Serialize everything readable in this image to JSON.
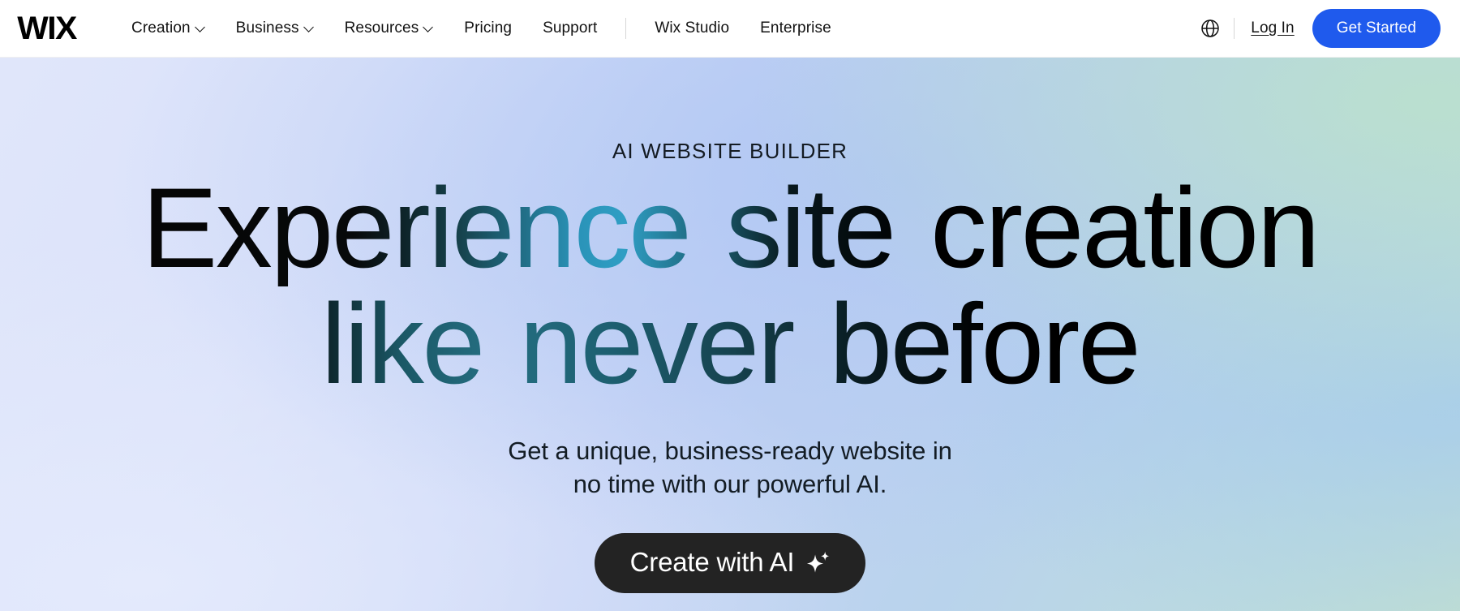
{
  "header": {
    "logo_text": "WIX",
    "nav_items": [
      {
        "label": "Creation",
        "has_dropdown": true,
        "name": "creation"
      },
      {
        "label": "Business",
        "has_dropdown": true,
        "name": "business"
      },
      {
        "label": "Resources",
        "has_dropdown": true,
        "name": "resources"
      },
      {
        "label": "Pricing",
        "has_dropdown": false,
        "name": "pricing"
      },
      {
        "label": "Support",
        "has_dropdown": false,
        "name": "support"
      }
    ],
    "nav_items_secondary": [
      {
        "label": "Wix Studio",
        "has_dropdown": false,
        "name": "wix-studio"
      },
      {
        "label": "Enterprise",
        "has_dropdown": false,
        "name": "enterprise"
      }
    ],
    "language_icon": "globe-icon",
    "login_label": "Log In",
    "get_started_label": "Get Started",
    "get_started_color": "#1f5aed"
  },
  "hero": {
    "eyebrow": "AI WEBSITE BUILDER",
    "headline_line_1": "Experience site creation",
    "headline_line_2": "like never before",
    "subhead_line_1": "Get a unique, business-ready website in",
    "subhead_line_2": "no time with our powerful AI.",
    "cta_label": "Create with AI",
    "cta_icon": "sparkle-icon",
    "cta_color": "#232323",
    "background_colors": {
      "top_left": "#dde3f7",
      "top_center": "#b6c9f0",
      "top_right": "#b8dcd0",
      "bottom_left": "#e3e9fa",
      "bottom_right": "#b5cfe8"
    },
    "headline_gradient": [
      "#050505",
      "#2f9ec4",
      "#000000"
    ]
  }
}
